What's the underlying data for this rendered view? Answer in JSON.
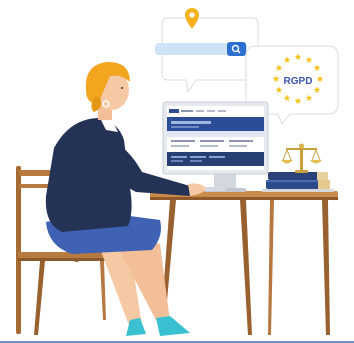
{
  "bubbles": {
    "search": {
      "icon": "location-pin-icon",
      "button_icon": "search-icon"
    },
    "rgpd": {
      "label": "RGPD",
      "stars": 12,
      "icon": "eu-stars-icon"
    }
  },
  "colors": {
    "accent_blue": "#2d6fd0",
    "skin": "#f6c9a5",
    "hair": "#f2a51f",
    "jacket": "#243256",
    "skirt": "#3f62b5",
    "shoes": "#39c0d1",
    "wood": "#a66a35",
    "eu_star": "#f7c21a",
    "rgpd_text": "#3d55b3",
    "floor_line": "#6f8fcf"
  },
  "icons": [
    "location-pin-icon",
    "search-icon",
    "eu-stars-icon",
    "scales-of-justice-icon",
    "book-stack-icon"
  ]
}
